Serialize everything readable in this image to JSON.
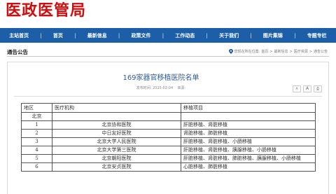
{
  "header": {
    "logo_text": "医政医管局"
  },
  "nav": {
    "items": [
      "主站首页",
      "首页",
      "最新信息",
      "政策文件",
      "工作动态",
      "关于我们",
      "图片集锦",
      "专题专栏"
    ],
    "separator": "|"
  },
  "section": {
    "title": "通告公告"
  },
  "breadcrumb": {
    "prefix": "您现在所在位置:",
    "items": [
      "首页",
      "最新信息",
      "医疗资源",
      "通告公告"
    ],
    "separator": ">"
  },
  "article": {
    "title": "169家器官移植医院名单",
    "date_label": "发布时间:",
    "date": "2015-02-04",
    "source_label": "来源:",
    "source": "",
    "tools": {
      "font_small": "A",
      "font_large": "A",
      "print": "⎙"
    }
  },
  "table": {
    "headers": [
      "地区",
      "医疗机构",
      "移植项目"
    ],
    "rows": [
      {
        "region": "北京",
        "hospital": "",
        "projects": ""
      },
      {
        "region": "1",
        "hospital": "北京协和医院",
        "projects": "肝脏移植、肾脏移植"
      },
      {
        "region": "2",
        "hospital": "中日友好医院",
        "projects": "肾脏移植、肺脏移植"
      },
      {
        "region": "3",
        "hospital": "北京大学人民医院",
        "projects": "肝脏移植、肾脏移植、小肠移植"
      },
      {
        "region": "4",
        "hospital": "北京大学第三医院",
        "projects": "肝脏移植、肾脏移植、胰腺移植、小肠移植"
      },
      {
        "region": "5",
        "hospital": "北京朝阳医院",
        "projects": "肝脏移植、肾脏移植、肺脏移植、胰腺移植、小肠移植"
      },
      {
        "region": "6",
        "hospital": "北京安贞医院",
        "projects": "心脏移植、肺脏移植"
      }
    ]
  },
  "colors": {
    "brand": "#d10c0c",
    "nav_bg": "#1c5fa8",
    "title_blue": "#2e5c9a"
  }
}
